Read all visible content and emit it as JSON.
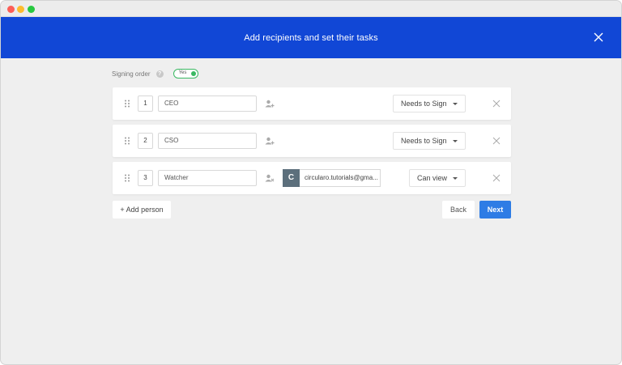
{
  "window": {
    "controls": [
      "close",
      "minimize",
      "maximize"
    ]
  },
  "header": {
    "title": "Add recipients and set their tasks",
    "close_icon": "close-icon"
  },
  "signing_order": {
    "label": "Signing order",
    "help_icon": "?",
    "toggle_label": "Yes",
    "toggle_on": true
  },
  "recipients": [
    {
      "order": "1",
      "role": "CEO",
      "task": "Needs to Sign"
    },
    {
      "order": "2",
      "role": "CSO",
      "task": "Needs to Sign"
    },
    {
      "order": "3",
      "role": "Watcher",
      "task": "Can view",
      "avatar_letter": "C",
      "email": "circularo.tutorials@gma..."
    }
  ],
  "actions": {
    "add_person": "+ Add person",
    "back": "Back",
    "next": "Next"
  },
  "colors": {
    "header_bg": "#1147d6",
    "primary_button": "#2e7ce5",
    "toggle_on": "#3ab862",
    "avatar_bg": "#5c6f7c"
  }
}
